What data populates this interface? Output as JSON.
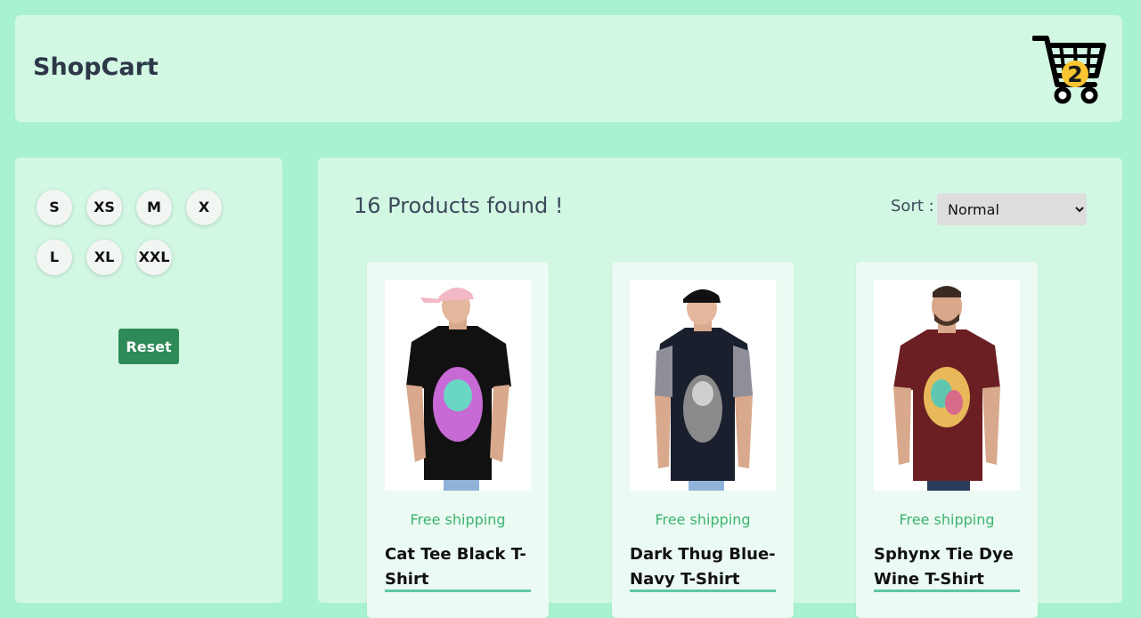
{
  "header": {
    "brand": "ShopCart",
    "cart_count": "2"
  },
  "filters": {
    "sizes": [
      "S",
      "XS",
      "M",
      "X",
      "L",
      "XL",
      "XXL"
    ],
    "reset_label": "Reset"
  },
  "results": {
    "found_text": "16 Products found !",
    "sort_label": "Sort :",
    "sort_selected": "Normal"
  },
  "products": [
    {
      "shipping": "Free shipping",
      "title": "Cat Tee Black T-Shirt",
      "shirt_color": "#111111",
      "art_color": "#c86ad6",
      "sleeve_color": "#111111",
      "hat_color": "#f2b8c6"
    },
    {
      "shipping": "Free shipping",
      "title": "Dark Thug Blue-Navy T-Shirt",
      "shirt_color": "#1a1f2e",
      "art_color": "#8a8a8a",
      "sleeve_color": "#8f8f9a",
      "hat_color": "#111111"
    },
    {
      "shipping": "Free shipping",
      "title": "Sphynx Tie Dye Wine T-Shirt",
      "shirt_color": "#6b1f22",
      "art_color": "#e8b85a",
      "sleeve_color": "#6b1f22",
      "hat_color": ""
    }
  ],
  "colors": {
    "page_bg": "#a8f2cf",
    "panel_bg": "#d2f8e4",
    "card_bg": "#ebfaf2",
    "accent": "#2e8b57",
    "shipping": "#3cb371",
    "badge": "#fbc531"
  }
}
